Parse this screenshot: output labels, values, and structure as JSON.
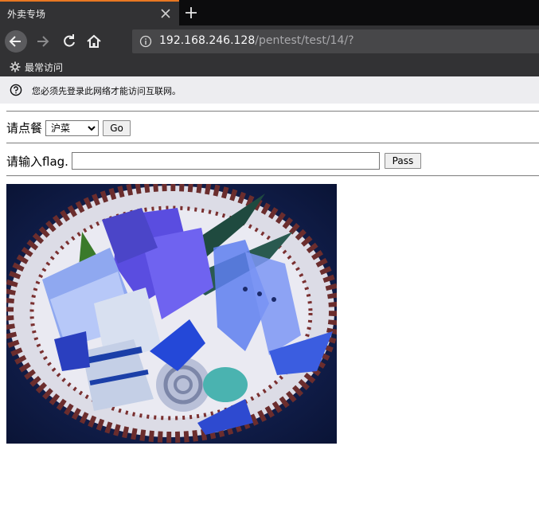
{
  "browser": {
    "tab_title": "外卖专场",
    "url_host": "192.168.246.128",
    "url_path": "/pentest/test/14/?",
    "bookmark_label": "最常访问",
    "notice_text": "您必须先登录此网络才能访问互联网。",
    "icons": {
      "tab_close": "close-icon",
      "new_tab": "plus-icon",
      "back": "arrow-left-icon",
      "forward": "arrow-right-icon",
      "reload": "reload-icon",
      "home": "home-icon",
      "site_info": "info-icon",
      "bookmark": "gear-icon",
      "notice": "question-icon"
    },
    "colors": {
      "tab_accent": "#e87722",
      "chrome_dark": "#323234",
      "notice_bg": "#ededf0"
    }
  },
  "page": {
    "order_label": "请点餐",
    "menu_selected": "沪菜",
    "menu_options": [
      "沪菜"
    ],
    "go_label": "Go",
    "flag_label": "请输入flag.",
    "flag_value": "",
    "pass_label": "Pass",
    "image_subject": "sashimi platter on blue-and-white plate"
  }
}
